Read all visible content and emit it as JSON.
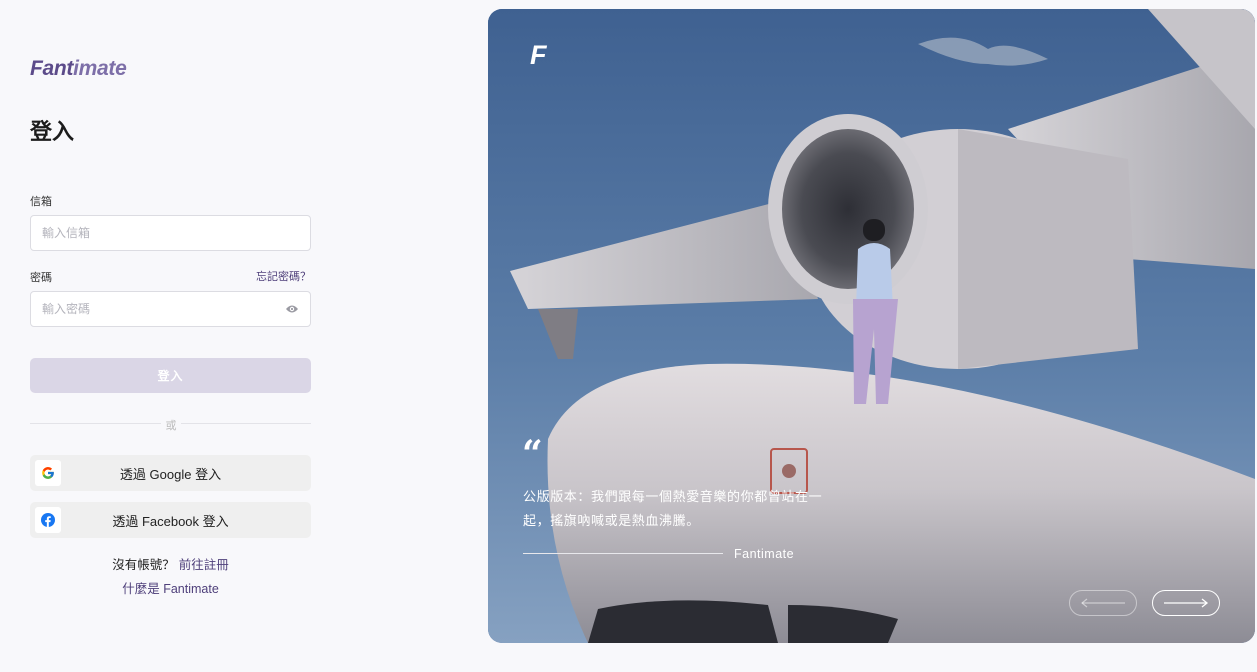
{
  "brand": {
    "logo_prefix": "Fant",
    "logo_suffix": "imate",
    "hero_mark": "F",
    "colors": {
      "primary": "#4e3f7a",
      "disabled_button": "#dad6e6"
    }
  },
  "login": {
    "title": "登入",
    "email_label": "信箱",
    "email_placeholder": "輸入信箱",
    "password_label": "密碼",
    "password_placeholder": "輸入密碼",
    "forgot_password": "忘記密碼？",
    "submit_label": "登入",
    "or_label": "或",
    "google_label": "透過 Google 登入",
    "facebook_label": "透過 Facebook 登入",
    "no_account": "沒有帳號？",
    "signup_link": "前往註冊",
    "about_link": "什麼是 Fantimate",
    "icons": {
      "password_toggle": "eye-icon",
      "google": "google-icon",
      "facebook": "facebook-icon"
    }
  },
  "hero": {
    "quote_mark": "“",
    "quote": "公版版本：我們跟每一個熱愛音樂的你都曾站在一起，搖旗吶喊或是熱血沸騰。",
    "author": "Fantimate",
    "icons": {
      "prev": "arrow-left-icon",
      "next": "arrow-right-icon"
    }
  }
}
